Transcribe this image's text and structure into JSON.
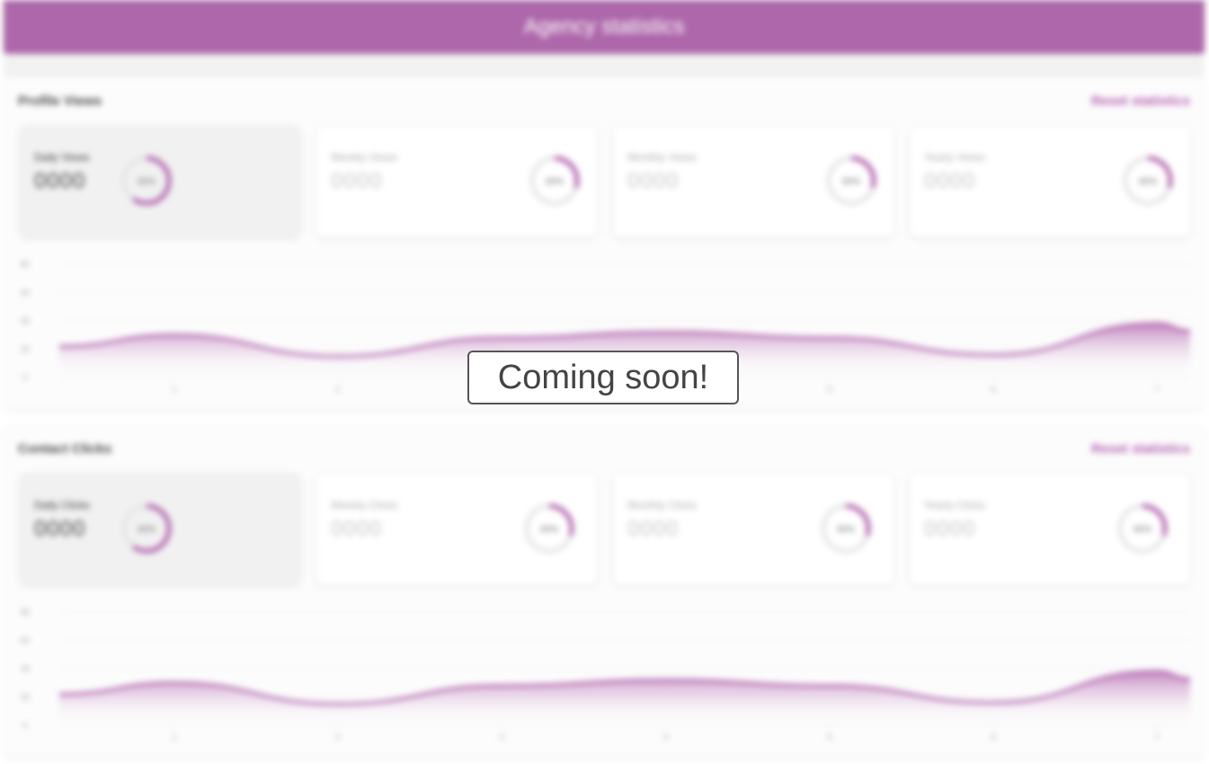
{
  "header": {
    "title": "Agency statistics"
  },
  "colors": {
    "accent": "#ad67aa",
    "link": "#b35cb0"
  },
  "overlay": {
    "text": "Coming soon!"
  },
  "sections": [
    {
      "title": "Profile Views",
      "reset_label": "Reset statistics",
      "cards": [
        {
          "label": "Daily Views",
          "value": "0000",
          "percent": "00%",
          "fraction": 0.6
        },
        {
          "label": "Weekly Views",
          "value": "0000",
          "percent": "00%",
          "fraction": 0.3
        },
        {
          "label": "Monthly Views",
          "value": "0000",
          "percent": "00%",
          "fraction": 0.3
        },
        {
          "label": "Yearly Views",
          "value": "0000",
          "percent": "00%",
          "fraction": 0.3
        }
      ]
    },
    {
      "title": "Contact Clicks",
      "reset_label": "Reset statistics",
      "cards": [
        {
          "label": "Daily Clicks",
          "value": "0000",
          "percent": "00%",
          "fraction": 0.6
        },
        {
          "label": "Weekly Clicks",
          "value": "0000",
          "percent": "00%",
          "fraction": 0.3
        },
        {
          "label": "Monthly Clicks",
          "value": "0000",
          "percent": "00%",
          "fraction": 0.3
        },
        {
          "label": "Yearly Clicks",
          "value": "0000",
          "percent": "00%",
          "fraction": 0.3
        }
      ]
    }
  ],
  "chart_data": [
    {
      "type": "area",
      "x": [
        0.3,
        1,
        2,
        3,
        4,
        5,
        6,
        7,
        7.2
      ],
      "y": [
        22,
        30,
        15,
        28,
        32,
        28,
        16,
        38,
        33
      ],
      "ylim": [
        0,
        80
      ],
      "yticks": [
        "0",
        "20",
        "40",
        "60",
        "80"
      ],
      "xticks": [
        "1",
        "2",
        "3",
        "4",
        "5",
        "6",
        "7"
      ]
    },
    {
      "type": "area",
      "x": [
        0.3,
        1,
        2,
        3,
        4,
        5,
        6,
        7,
        7.2
      ],
      "y": [
        22,
        30,
        15,
        28,
        32,
        28,
        16,
        38,
        33
      ],
      "ylim": [
        0,
        80
      ],
      "yticks": [
        "0",
        "20",
        "40",
        "60",
        "80"
      ],
      "xticks": [
        "1",
        "2",
        "3",
        "4",
        "5",
        "6",
        "7"
      ]
    }
  ]
}
